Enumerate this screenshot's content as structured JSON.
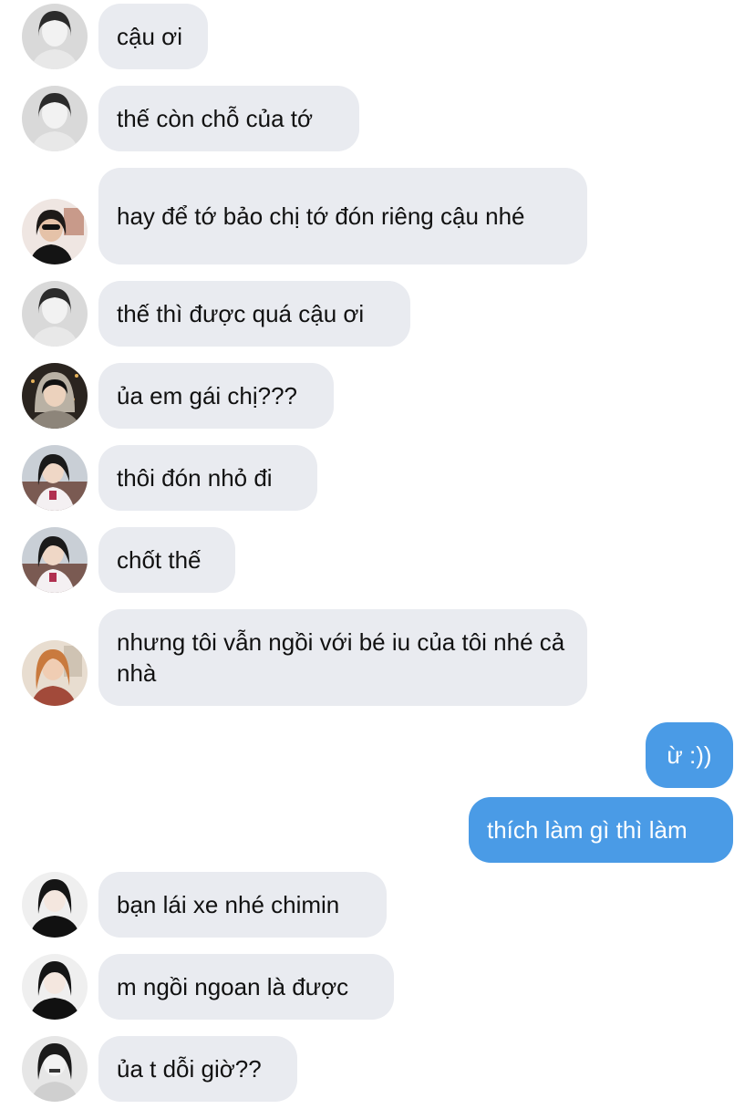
{
  "messages": [
    {
      "dir": "received",
      "avatar": "avatar-1",
      "text": "cậu ơi"
    },
    {
      "dir": "received",
      "avatar": "avatar-1",
      "text": "thế còn chỗ của tớ"
    },
    {
      "dir": "received",
      "avatar": "avatar-2",
      "text": "hay để tớ bảo chị tớ đón riêng cậu nhé"
    },
    {
      "dir": "received",
      "avatar": "avatar-1",
      "text": "thế thì được quá cậu ơi"
    },
    {
      "dir": "received",
      "avatar": "avatar-3",
      "text": "ủa em gái chị???"
    },
    {
      "dir": "received",
      "avatar": "avatar-4",
      "text": "thôi đón nhỏ đi"
    },
    {
      "dir": "received",
      "avatar": "avatar-4",
      "text": "chốt thế"
    },
    {
      "dir": "received",
      "avatar": "avatar-5",
      "text": "nhưng tôi vẫn ngồi với bé iu của tôi nhé cả nhà"
    },
    {
      "dir": "sent",
      "text": "ừ :))"
    },
    {
      "dir": "sent",
      "text": "thích làm gì thì làm"
    },
    {
      "dir": "received",
      "avatar": "avatar-6",
      "text": "bạn lái xe nhé chimin"
    },
    {
      "dir": "received",
      "avatar": "avatar-6",
      "text": "m ngồi ngoan là được"
    },
    {
      "dir": "received",
      "avatar": "avatar-7",
      "text": "ủa t dỗi giờ??"
    }
  ],
  "colors": {
    "received_bubble": "#e9ebf0",
    "sent_bubble": "#4a9be6",
    "received_text": "#111111",
    "sent_text": "#ffffff",
    "background": "#ffffff"
  }
}
